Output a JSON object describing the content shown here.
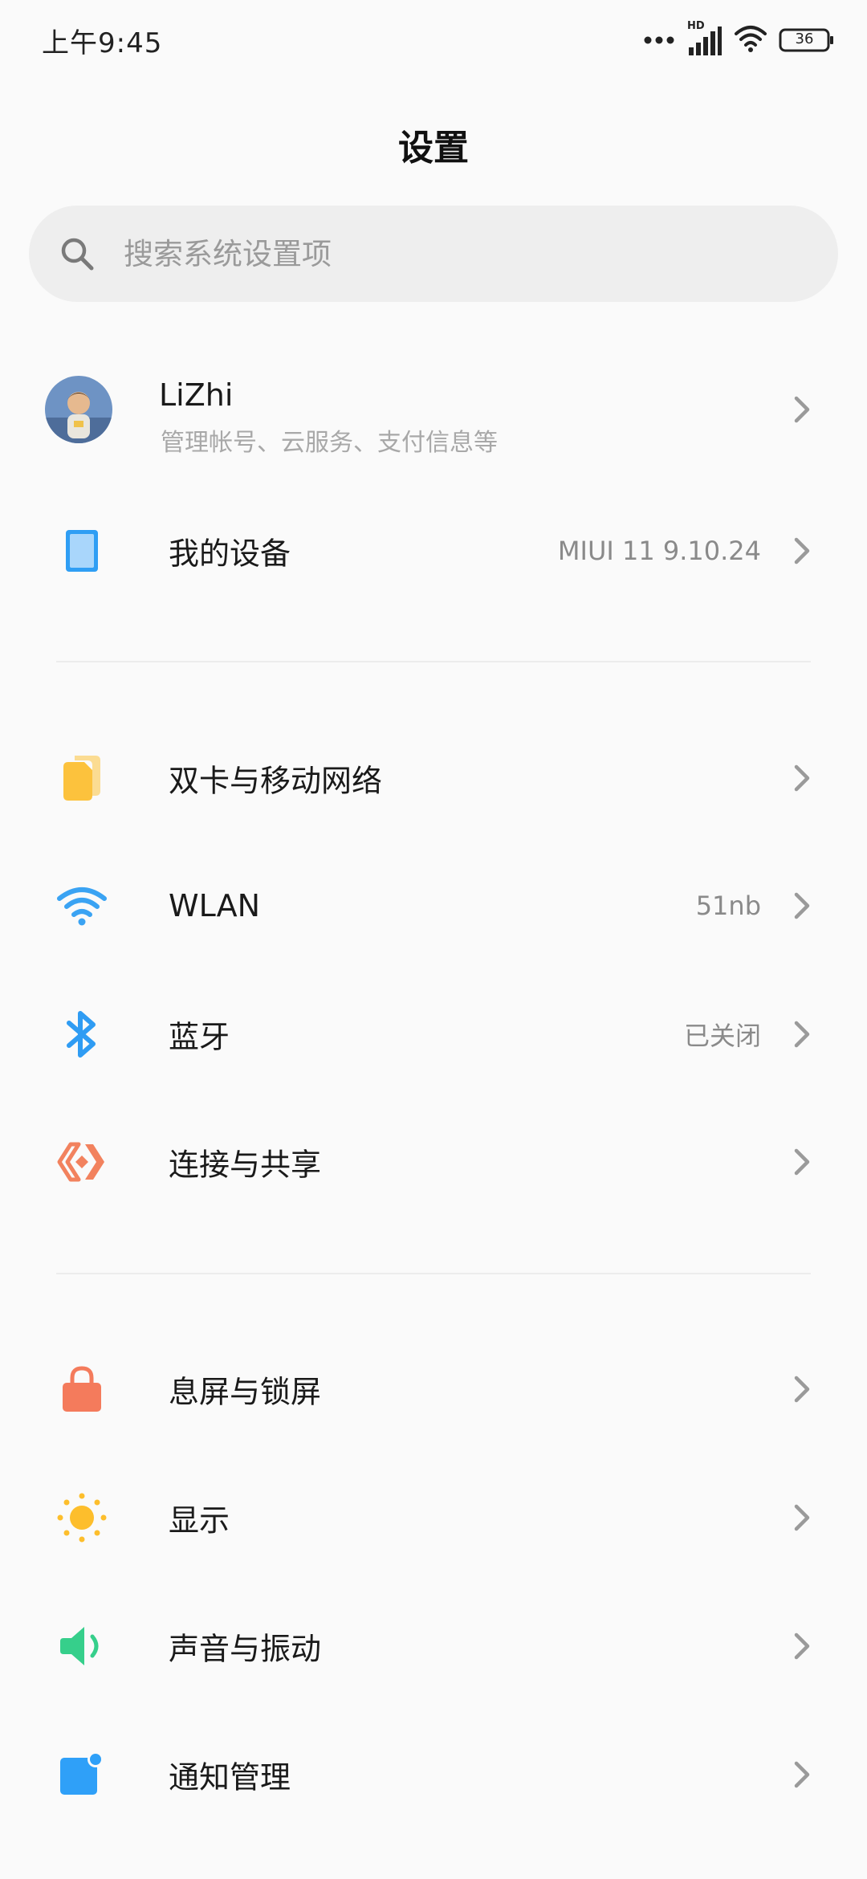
{
  "status_bar": {
    "time": "上午9:45",
    "network_badge": "HD",
    "battery": "36"
  },
  "page": {
    "title": "设置"
  },
  "search": {
    "placeholder": "搜索系统设置项",
    "icon": "search-icon"
  },
  "account": {
    "name": "LiZhi",
    "subtitle": "管理帐号、云服务、支付信息等"
  },
  "device": {
    "label": "我的设备",
    "value": "MIUI 11 9.10.24"
  },
  "network_section": [
    {
      "label": "双卡与移动网络",
      "value": "",
      "icon": "sim-card-icon",
      "color": "#fcc23d"
    },
    {
      "label": "WLAN",
      "value": "51nb",
      "icon": "wifi-icon",
      "color": "#3aa3f3"
    },
    {
      "label": "蓝牙",
      "value": "已关闭",
      "icon": "bluetooth-icon",
      "color": "#2f9cf3"
    },
    {
      "label": "连接与共享",
      "value": "",
      "icon": "share-icon",
      "color": "#f2825e"
    }
  ],
  "display_section": [
    {
      "label": "息屏与锁屏",
      "value": "",
      "icon": "lock-icon",
      "color": "#f47b5c"
    },
    {
      "label": "显示",
      "value": "",
      "icon": "sun-icon",
      "color": "#fdbe2c"
    },
    {
      "label": "声音与振动",
      "value": "",
      "icon": "speaker-icon",
      "color": "#36cf8b"
    },
    {
      "label": "通知管理",
      "value": "",
      "icon": "notification-icon",
      "color": "#2fa0f8"
    }
  ]
}
